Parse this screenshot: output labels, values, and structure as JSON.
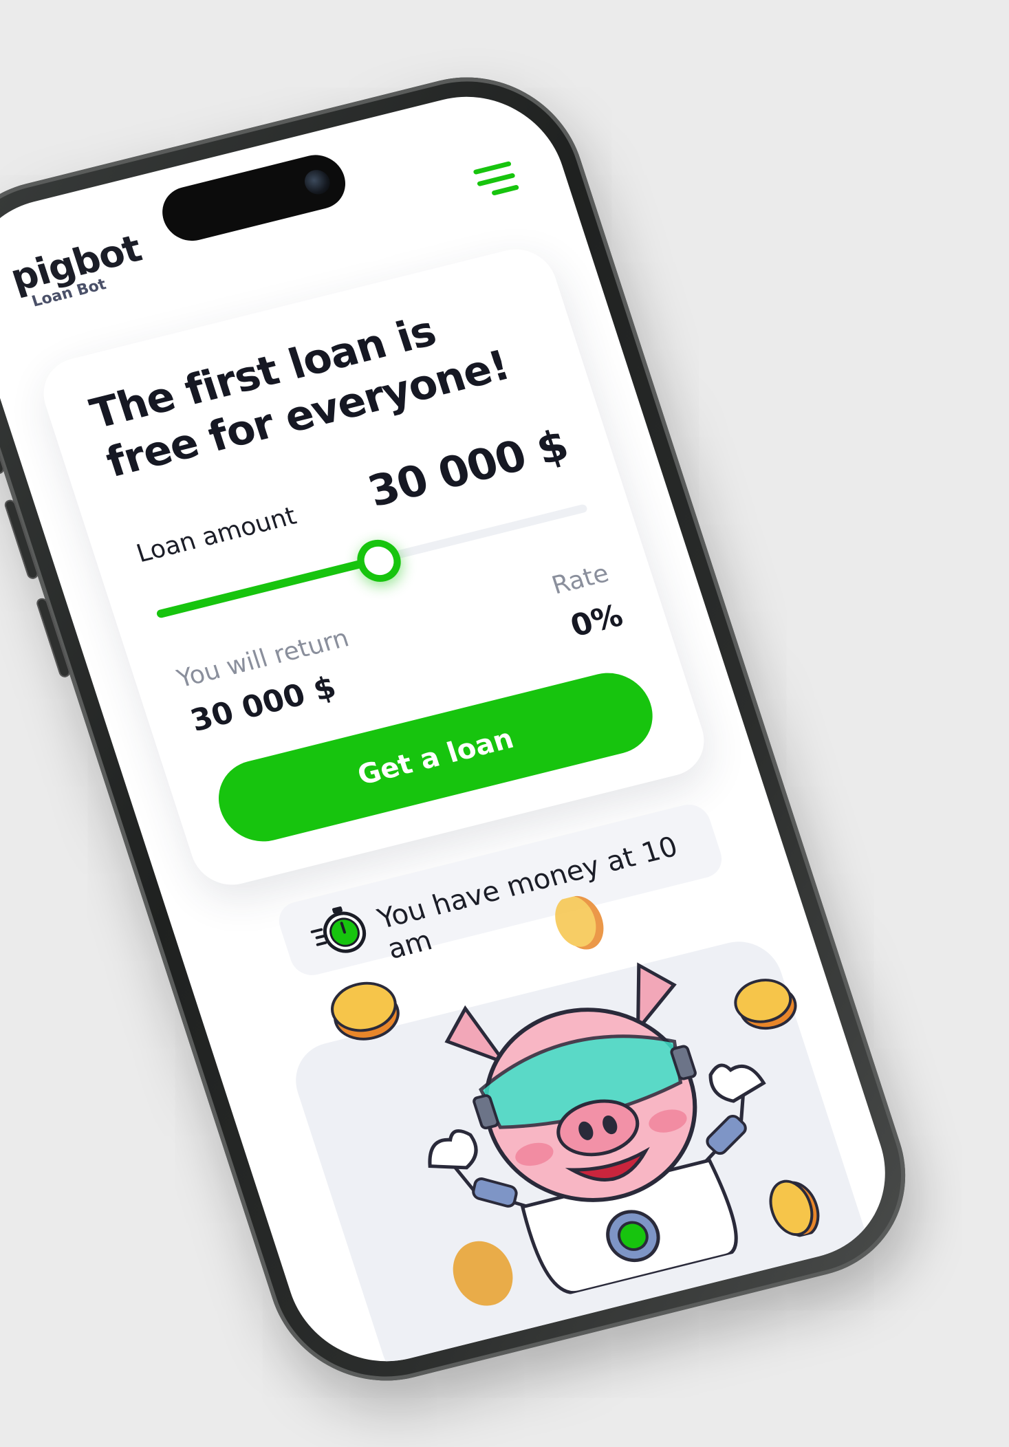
{
  "brand": {
    "name": "pigbot",
    "subtitle": "Loan Bot",
    "accent_color": "#17c40e"
  },
  "header": {
    "menu_icon": "hamburger-menu-icon"
  },
  "loan_card": {
    "headline": "The first loan is free for everyone!",
    "amount_label": "Loan amount",
    "amount_value": "30 000 $",
    "slider_fraction": 0.5,
    "return_label": "You will return",
    "return_value": "30 000 $",
    "rate_label": "Rate",
    "rate_value": "0%",
    "cta_label": "Get a loan"
  },
  "notice": {
    "icon": "stopwatch-icon",
    "text": "You have money at 10 am"
  },
  "illustration": {
    "subject": "pig-astronaut-mascot",
    "elements": [
      "gold-coin-icon"
    ]
  }
}
